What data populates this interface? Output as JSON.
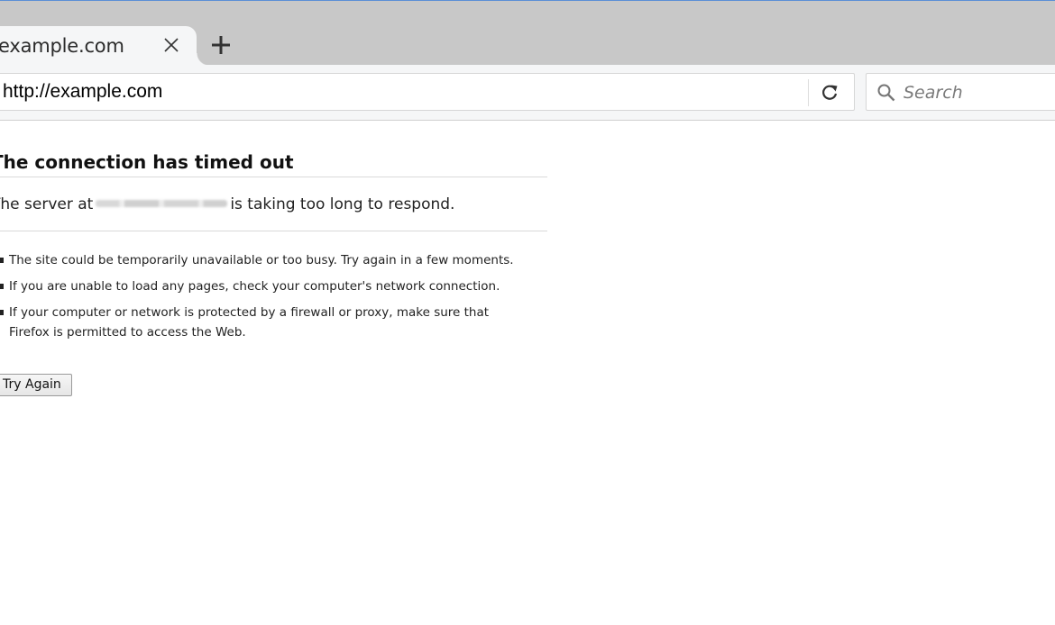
{
  "tab": {
    "title": "example.com",
    "close_icon": "close-icon",
    "new_tab_icon": "plus-icon"
  },
  "navbar": {
    "url": "http://example.com",
    "reload_icon": "reload-icon",
    "search": {
      "icon": "search-icon",
      "placeholder": "Search"
    }
  },
  "error": {
    "title": "The connection has timed out",
    "desc_prefix": "The server at",
    "desc_suffix": "is taking too long to respond.",
    "suggestions": [
      "The site could be temporarily unavailable or too busy. Try again in a few moments.",
      "If you are unable to load any pages, check your computer's network connection.",
      "If your computer or network is protected by a firewall or proxy, make sure that Firefox is permitted to access the Web."
    ],
    "try_again_label": "Try Again"
  },
  "colors": {
    "tabstrip_bg": "#c8c8c8",
    "toolbar_bg": "#f5f6f7",
    "accent_topline": "#5b8fd6"
  }
}
